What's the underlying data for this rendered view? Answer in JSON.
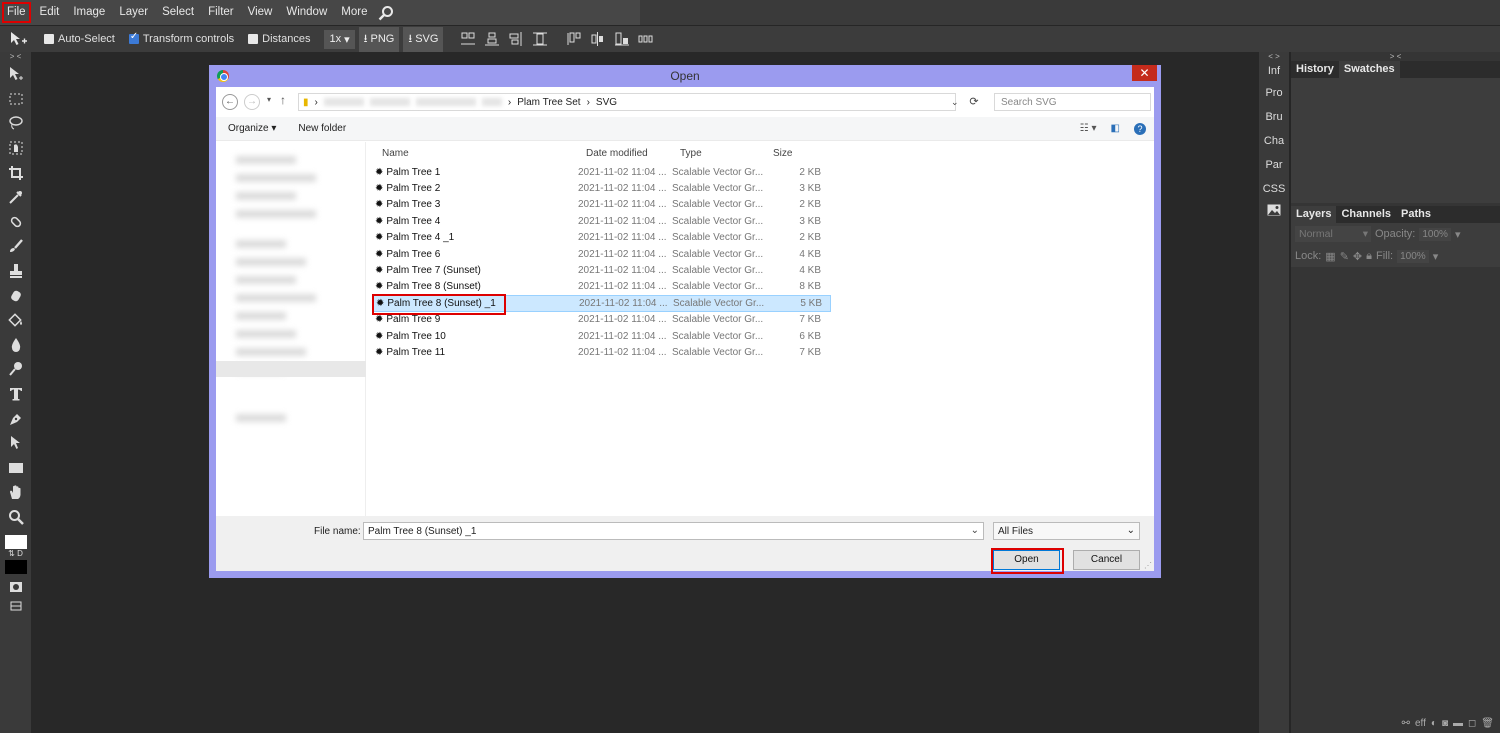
{
  "menu": {
    "items": [
      "File",
      "Edit",
      "Image",
      "Layer",
      "Select",
      "Filter",
      "View",
      "Window",
      "More"
    ]
  },
  "options": {
    "auto_select": "Auto-Select",
    "transform_controls": "Transform controls",
    "distances": "Distances",
    "zoom": "1x",
    "png": "PNG",
    "svg": "SVG"
  },
  "mini_panels": [
    "Inf",
    "Pro",
    "Bru",
    "Cha",
    "Par",
    "CSS"
  ],
  "panels": {
    "top_tabs": [
      "History",
      "Swatches"
    ],
    "layer_tabs": [
      "Layers",
      "Channels",
      "Paths"
    ],
    "blend_mode": "Normal",
    "opacity_label": "Opacity:",
    "opacity_value": "100%",
    "lock_label": "Lock:",
    "fill_label": "Fill:",
    "fill_value": "100%",
    "footer_eff": "eff"
  },
  "dialog": {
    "title": "Open",
    "close": "✕",
    "path": [
      "Plam Tree Set",
      "SVG"
    ],
    "search_placeholder": "Search SVG",
    "organize": "Organize ▾",
    "new_folder": "New folder",
    "columns": [
      "Name",
      "Date modified",
      "Type",
      "Size"
    ],
    "files": [
      {
        "name": "Palm Tree 1",
        "date": "2021-11-02 11:04 ...",
        "type": "Scalable Vector Gr...",
        "size": "2 KB"
      },
      {
        "name": "Palm Tree 2",
        "date": "2021-11-02 11:04 ...",
        "type": "Scalable Vector Gr...",
        "size": "3 KB"
      },
      {
        "name": "Palm Tree 3",
        "date": "2021-11-02 11:04 ...",
        "type": "Scalable Vector Gr...",
        "size": "2 KB"
      },
      {
        "name": "Palm Tree 4",
        "date": "2021-11-02 11:04 ...",
        "type": "Scalable Vector Gr...",
        "size": "3 KB"
      },
      {
        "name": "Palm Tree 4 _1",
        "date": "2021-11-02 11:04 ...",
        "type": "Scalable Vector Gr...",
        "size": "2 KB"
      },
      {
        "name": "Palm Tree 6",
        "date": "2021-11-02 11:04 ...",
        "type": "Scalable Vector Gr...",
        "size": "4 KB"
      },
      {
        "name": "Palm Tree 7 (Sunset)",
        "date": "2021-11-02 11:04 ...",
        "type": "Scalable Vector Gr...",
        "size": "4 KB"
      },
      {
        "name": "Palm Tree 8 (Sunset)",
        "date": "2021-11-02 11:04 ...",
        "type": "Scalable Vector Gr...",
        "size": "8 KB"
      },
      {
        "name": "Palm Tree 8 (Sunset) _1",
        "date": "2021-11-02 11:04 ...",
        "type": "Scalable Vector Gr...",
        "size": "5 KB"
      },
      {
        "name": "Palm Tree 9",
        "date": "2021-11-02 11:04 ...",
        "type": "Scalable Vector Gr...",
        "size": "7 KB"
      },
      {
        "name": "Palm Tree 10",
        "date": "2021-11-02 11:04 ...",
        "type": "Scalable Vector Gr...",
        "size": "6 KB"
      },
      {
        "name": "Palm Tree 11",
        "date": "2021-11-02 11:04 ...",
        "type": "Scalable Vector Gr...",
        "size": "7 KB"
      }
    ],
    "selected_file_index": 8,
    "file_name_label": "File name:",
    "file_name_value": "Palm Tree 8 (Sunset) _1",
    "filter": "All Files",
    "open_btn": "Open",
    "cancel_btn": "Cancel"
  },
  "colors": {
    "dialog_frame": "#9b9bef",
    "highlight": "#dd0000",
    "selection": "#cce8ff"
  }
}
